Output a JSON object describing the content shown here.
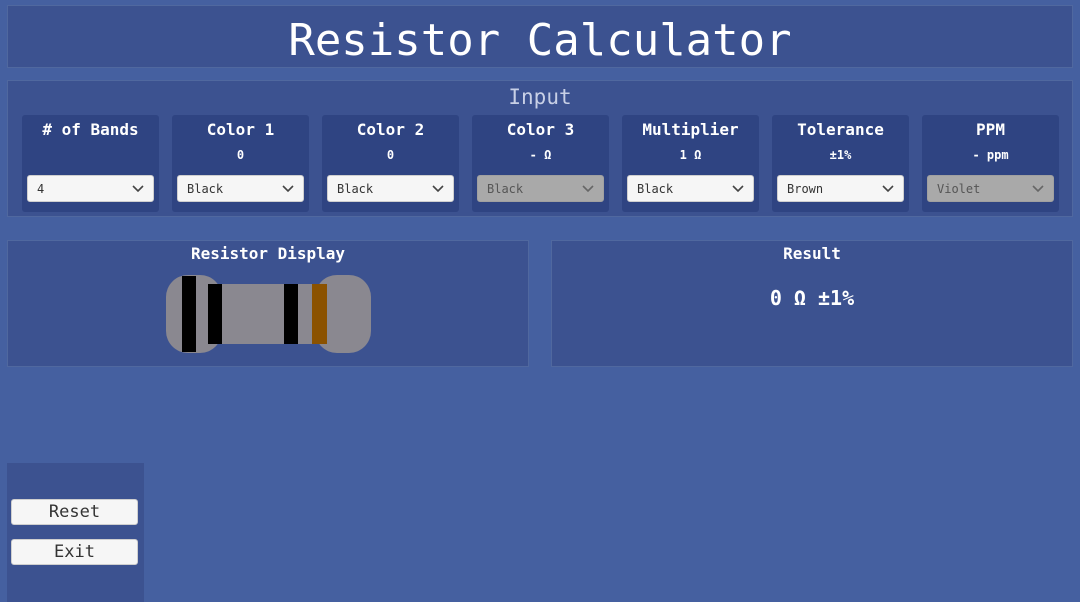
{
  "app": {
    "title": "Resistor Calculator"
  },
  "input": {
    "heading": "Input",
    "cards": [
      {
        "title": "# of Bands",
        "value": "",
        "selected": "4",
        "disabled": false
      },
      {
        "title": "Color 1",
        "value": "0",
        "selected": "Black",
        "disabled": false
      },
      {
        "title": "Color 2",
        "value": "0",
        "selected": "Black",
        "disabled": false
      },
      {
        "title": "Color 3",
        "value": "- Ω",
        "selected": "Black",
        "disabled": true
      },
      {
        "title": "Multiplier",
        "value": "1 Ω",
        "selected": "Black",
        "disabled": false
      },
      {
        "title": "Tolerance",
        "value": "±1%",
        "selected": "Brown",
        "disabled": false
      },
      {
        "title": "PPM",
        "value": "- ppm",
        "selected": "Violet",
        "disabled": true
      }
    ]
  },
  "display": {
    "heading": "Resistor Display",
    "body_color": "#8a8890",
    "bands": [
      {
        "color": "#000000"
      },
      {
        "color": "#000000"
      },
      {
        "color": "#000000"
      },
      {
        "color": "#8b5200"
      }
    ]
  },
  "result": {
    "heading": "Result",
    "value": "0 Ω ±1%"
  },
  "actions": {
    "reset_label": "Reset",
    "exit_label": "Exit"
  },
  "colors": {
    "background": "#4560a0",
    "panel": "#3c5290",
    "card": "#2f4482"
  }
}
